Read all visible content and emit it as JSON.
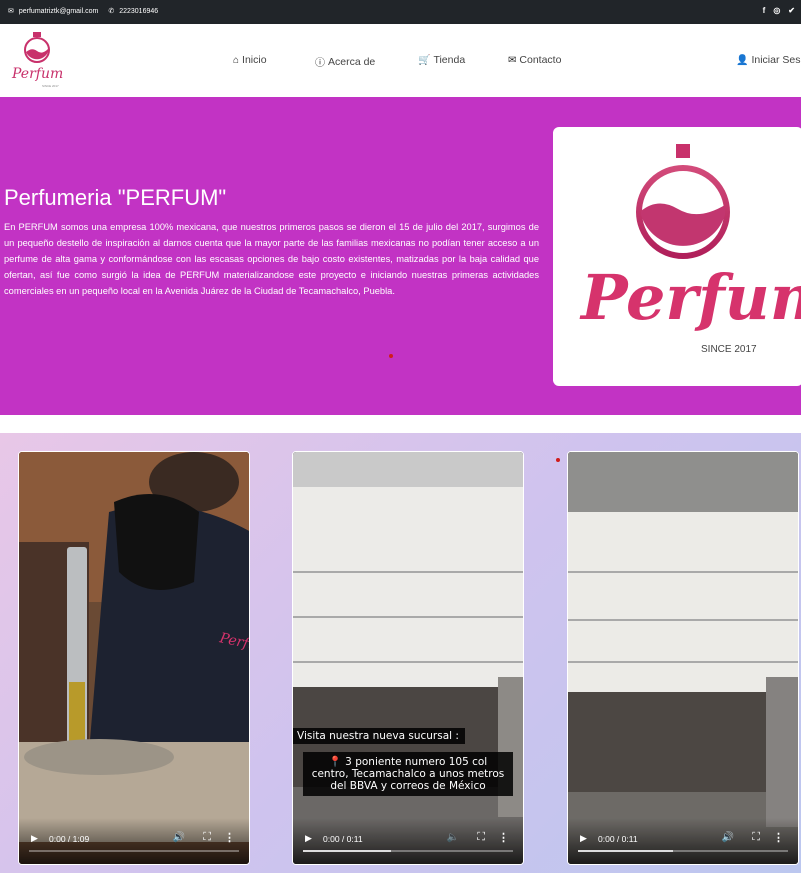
{
  "topbar": {
    "email": "perfumatriztk@gmail.com",
    "phone": "2223016946",
    "social": [
      "facebook-icon",
      "instagram-icon",
      "twitter-icon"
    ]
  },
  "nav": {
    "logo_text": "Perfum",
    "items": [
      {
        "label": "Inicio",
        "icon": "home-icon"
      },
      {
        "label": "Acerca de",
        "icon": "info-icon"
      },
      {
        "label": "Tienda",
        "icon": "cart-icon"
      },
      {
        "label": "Contacto",
        "icon": "envelope-icon"
      },
      {
        "label": "Iniciar Sesi",
        "icon": "user-icon"
      }
    ]
  },
  "hero": {
    "title": "Perfumeria \"PERFUM\"",
    "text": "En PERFUM somos una empresa 100% mexicana, que nuestros primeros pasos se dieron el 15 de julio del 2017, surgimos de un pequeño destello de inspiración al darnos cuenta que la mayor parte de las familias mexicanas no podían tener acceso a un perfume de alta gama y conformándose con las escasas opciones de bajo costo existentes, matizadas por la baja calidad que ofertan, así fue como surgió la idea de PERFUM materializandose este proyecto e iniciando nuestras primeras actividades comerciales en un pequeño local en la Avenida Juárez de la Ciudad de Tecamachalco, Puebla.",
    "logo_word": "Perfum",
    "logo_since": "SINCE 2017"
  },
  "colors": {
    "hero_bg": "#c233c4",
    "topbar_bg": "#212529",
    "brand_pink": "#d6336c"
  },
  "videos": [
    {
      "time": "0:00 / 1:09",
      "progress": 0.0
    },
    {
      "time": "0:00 / 0:11",
      "progress": 0.42,
      "caption_line1": "Visita nuestra nueva sucursal :",
      "caption_line2": "📍 3 poniente numero 105 col centro, Tecamachalco a unos metros del BBVA y correos de México"
    },
    {
      "time": "0:00 / 0:11",
      "progress": 0.45
    }
  ]
}
